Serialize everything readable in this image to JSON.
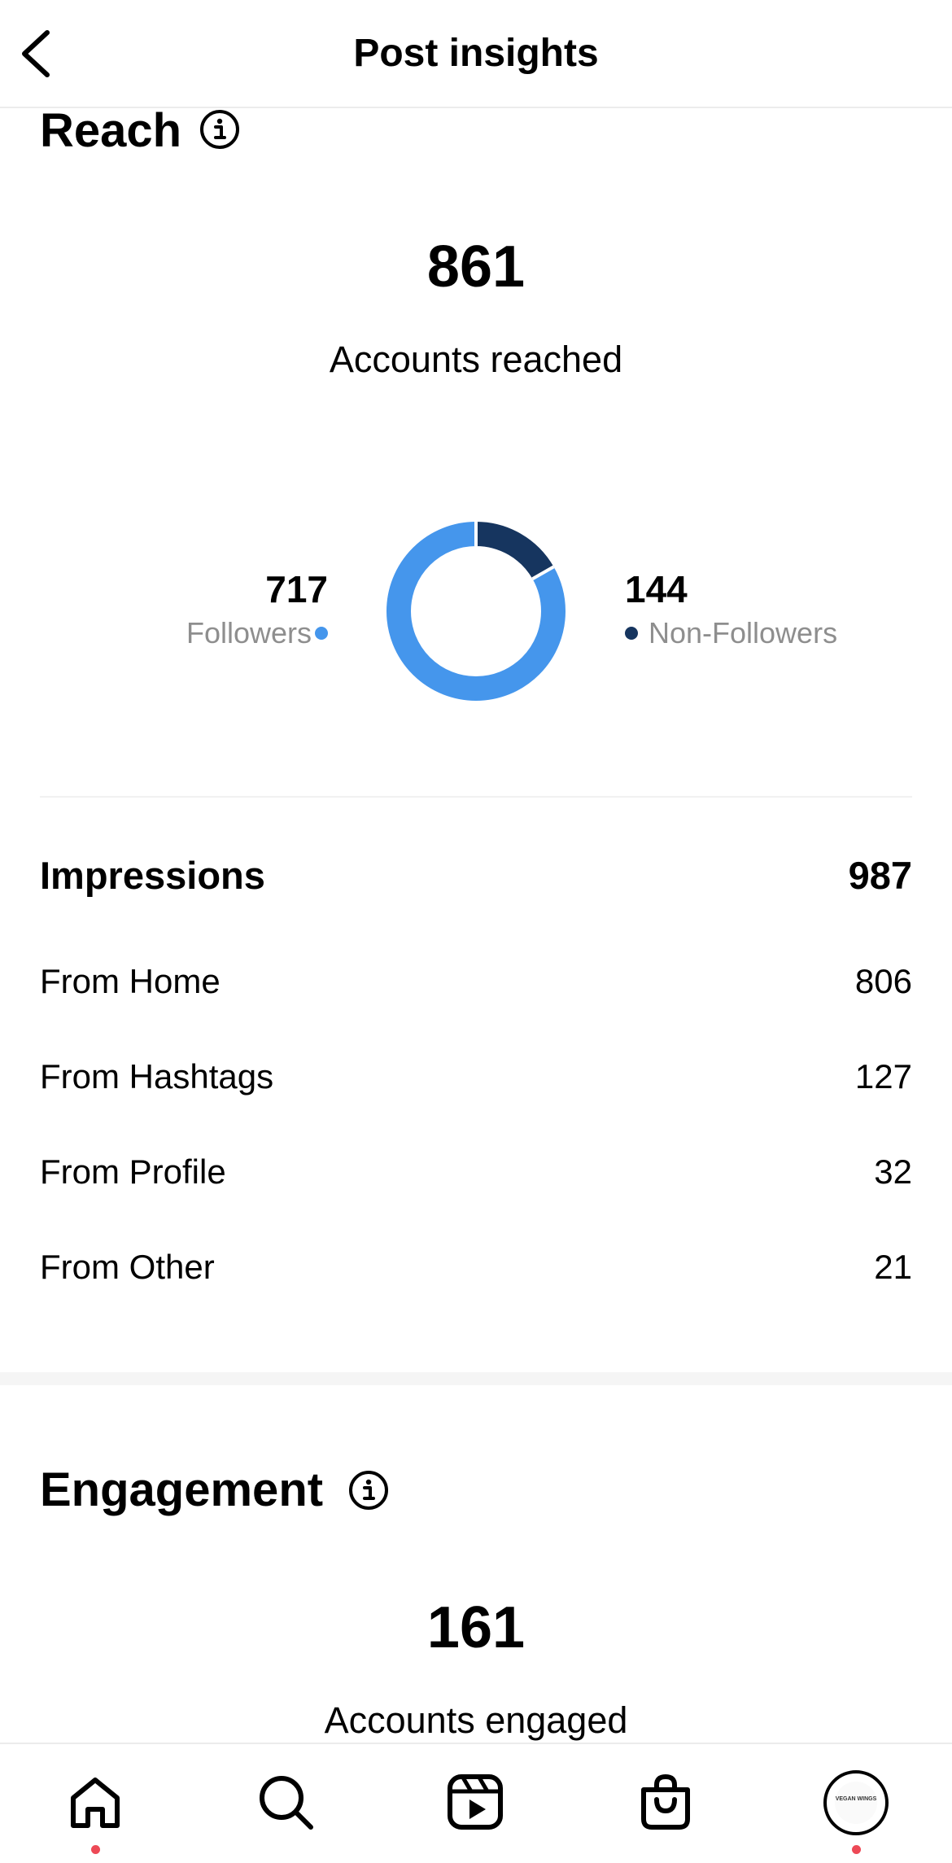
{
  "header": {
    "title": "Post insights"
  },
  "reach": {
    "title": "Reach",
    "accounts_reached": "861",
    "accounts_reached_label": "Accounts reached",
    "followers_value": "717",
    "followers_label": "Followers",
    "non_followers_value": "144",
    "non_followers_label": "Non-Followers",
    "colors": {
      "followers": "#4596ec",
      "non_followers": "#16355f"
    }
  },
  "impressions": {
    "title": "Impressions",
    "total": "987",
    "rows": [
      {
        "label": "From Home",
        "value": "806"
      },
      {
        "label": "From Hashtags",
        "value": "127"
      },
      {
        "label": "From Profile",
        "value": "32"
      },
      {
        "label": "From Other",
        "value": "21"
      }
    ]
  },
  "engagement": {
    "title": "Engagement",
    "accounts_engaged": "161",
    "accounts_engaged_label": "Accounts engaged"
  },
  "nav": {
    "items": [
      "home-icon",
      "search-icon",
      "reels-icon",
      "shop-icon",
      "profile-avatar"
    ],
    "avatar_text": "VEGAN WINGS"
  }
}
